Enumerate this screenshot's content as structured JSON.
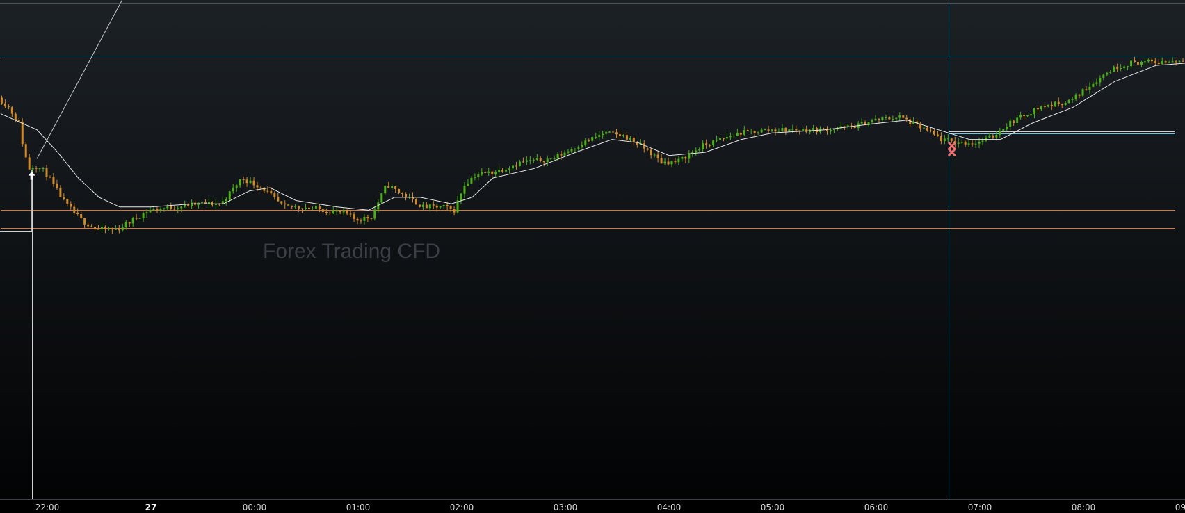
{
  "watermark": "Forex Trading CFD",
  "colors": {
    "background_top": "#1c2126",
    "background_bottom": "#020304",
    "candle_up": "#4caf1a",
    "candle_down": "#d08a2a",
    "moving_average": "#e8e8e8",
    "horizontal_cyan": "#6ec6df",
    "horizontal_orange": "#e8722a",
    "vertical_line": "#d0d0d0",
    "stop_marker": "#f07070",
    "axis_text": "#d8d8d8"
  },
  "icons": {
    "entry_marker": "up-arrow-icon",
    "stop_marker": "x-mark-icon"
  },
  "chart_data": {
    "type": "candlestick",
    "xlabel": "",
    "ylabel": "",
    "grid": false,
    "legend": "none",
    "x_ticks": [
      {
        "label": "22:00",
        "hour": -2.0,
        "bold": false
      },
      {
        "label": "27",
        "hour": -1.0,
        "bold": true
      },
      {
        "label": "00:00",
        "hour": 0.0,
        "bold": false
      },
      {
        "label": "01:00",
        "hour": 1.0,
        "bold": false
      },
      {
        "label": "02:00",
        "hour": 2.0,
        "bold": false
      },
      {
        "label": "03:00",
        "hour": 3.0,
        "bold": false
      },
      {
        "label": "04:00",
        "hour": 4.0,
        "bold": false
      },
      {
        "label": "05:00",
        "hour": 5.0,
        "bold": false
      },
      {
        "label": "06:00",
        "hour": 6.0,
        "bold": false
      },
      {
        "label": "07:00",
        "hour": 7.0,
        "bold": false
      },
      {
        "label": "08:00",
        "hour": 8.0,
        "bold": false
      },
      {
        "label": "09:00",
        "hour": 9.0,
        "bold": false
      }
    ],
    "xlim": [
      -2.45,
      9.12
    ],
    "ylim": [
      0,
      100
    ],
    "price_path": [
      [
        -2.45,
        55
      ],
      [
        -2.35,
        52
      ],
      [
        -2.25,
        47
      ],
      [
        -2.2,
        38
      ],
      [
        -2.15,
        33
      ],
      [
        -2.1,
        34
      ],
      [
        -2.0,
        32
      ],
      [
        -1.9,
        27
      ],
      [
        -1.8,
        22
      ],
      [
        -1.65,
        17
      ],
      [
        -1.5,
        14
      ],
      [
        -1.3,
        14
      ],
      [
        -1.0,
        20
      ],
      [
        -0.5,
        22
      ],
      [
        -0.3,
        22
      ],
      [
        -0.1,
        30
      ],
      [
        0.1,
        27
      ],
      [
        0.3,
        21
      ],
      [
        0.5,
        21
      ],
      [
        0.7,
        20
      ],
      [
        0.9,
        19
      ],
      [
        1.0,
        17
      ],
      [
        1.15,
        18
      ],
      [
        1.3,
        28
      ],
      [
        1.5,
        24
      ],
      [
        1.65,
        21
      ],
      [
        1.85,
        21
      ],
      [
        1.95,
        20
      ],
      [
        2.05,
        28
      ],
      [
        2.15,
        31
      ],
      [
        2.35,
        32
      ],
      [
        2.6,
        35
      ],
      [
        2.9,
        36
      ],
      [
        3.2,
        41
      ],
      [
        3.4,
        44
      ],
      [
        3.6,
        43
      ],
      [
        3.8,
        39
      ],
      [
        3.95,
        35
      ],
      [
        4.1,
        35
      ],
      [
        4.35,
        40
      ],
      [
        4.7,
        44
      ],
      [
        5.0,
        45
      ],
      [
        5.5,
        45
      ],
      [
        5.8,
        46
      ],
      [
        6.0,
        48
      ],
      [
        6.25,
        49
      ],
      [
        6.5,
        45
      ],
      [
        6.65,
        42
      ],
      [
        6.8,
        41
      ],
      [
        7.0,
        41
      ],
      [
        7.15,
        43
      ],
      [
        7.3,
        47
      ],
      [
        7.6,
        52
      ],
      [
        7.9,
        54
      ],
      [
        8.05,
        58
      ],
      [
        8.3,
        64
      ],
      [
        8.5,
        66
      ],
      [
        8.75,
        66
      ],
      [
        9.12,
        67
      ]
    ],
    "moving_average": [
      [
        -2.45,
        50
      ],
      [
        -2.1,
        45
      ],
      [
        -1.9,
        38
      ],
      [
        -1.7,
        30
      ],
      [
        -1.5,
        24
      ],
      [
        -1.3,
        21
      ],
      [
        -1.0,
        21
      ],
      [
        -0.6,
        22
      ],
      [
        -0.3,
        22
      ],
      [
        -0.05,
        26
      ],
      [
        0.15,
        27
      ],
      [
        0.4,
        23
      ],
      [
        0.8,
        21
      ],
      [
        1.1,
        20
      ],
      [
        1.35,
        24
      ],
      [
        1.6,
        24
      ],
      [
        1.9,
        22
      ],
      [
        2.1,
        24
      ],
      [
        2.3,
        30
      ],
      [
        2.7,
        33
      ],
      [
        3.1,
        38
      ],
      [
        3.45,
        42
      ],
      [
        3.7,
        41
      ],
      [
        4.0,
        37
      ],
      [
        4.35,
        38
      ],
      [
        4.7,
        42
      ],
      [
        5.0,
        44
      ],
      [
        5.5,
        45
      ],
      [
        6.0,
        47
      ],
      [
        6.3,
        48
      ],
      [
        6.6,
        45
      ],
      [
        6.9,
        42
      ],
      [
        7.2,
        42
      ],
      [
        7.5,
        47
      ],
      [
        7.9,
        52
      ],
      [
        8.3,
        60
      ],
      [
        8.7,
        65
      ],
      [
        9.12,
        66
      ]
    ],
    "horizontal_levels": [
      {
        "value": 68,
        "color": "cyan",
        "from_hour": -2.45
      },
      {
        "value": 20,
        "color": "orange",
        "from_hour": -2.45
      },
      {
        "value": 14.5,
        "color": "orange",
        "from_hour": -2.45
      },
      {
        "value": 44.5,
        "color": "white",
        "from_hour": 6.7
      },
      {
        "value": 43.8,
        "color": "cyan",
        "from_hour": 6.7
      }
    ],
    "entry": {
      "hour": -2.15,
      "value": 32.5
    },
    "stops": [
      {
        "hour": 6.73,
        "value": 40
      },
      {
        "hour": 6.73,
        "value": 38
      }
    ],
    "vertical_lines": [
      {
        "hour": -2.15,
        "color": "white"
      },
      {
        "hour": 6.7,
        "color": "cyan"
      }
    ],
    "trend_line": {
      "from": [
        -2.1,
        36
      ],
      "to": [
        -0.85,
        111
      ]
    },
    "step_line": {
      "from_hour": -2.45,
      "to_hour": -2.15,
      "value": 13.5
    }
  }
}
